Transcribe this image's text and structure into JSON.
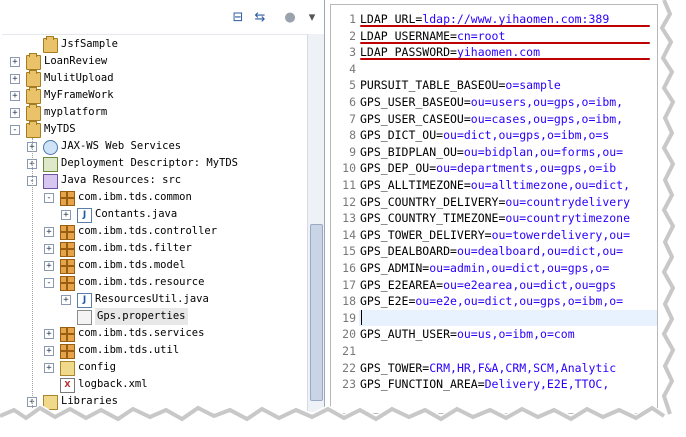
{
  "explorer": {
    "toolbar": [
      {
        "icon": "collapse-all-icon"
      },
      {
        "icon": "link-with-editor-icon"
      },
      {
        "icon": "view-menu-icon"
      },
      {
        "icon": "chevron-down-icon"
      }
    ],
    "tree": [
      {
        "label": "JsfSample",
        "icon": "project-icon",
        "depth": 1,
        "toggle": ""
      },
      {
        "label": "LoanReview",
        "icon": "project-icon",
        "depth": 0,
        "toggle": "+"
      },
      {
        "label": "MulitUpload",
        "icon": "project-icon",
        "depth": 0,
        "toggle": "+"
      },
      {
        "label": "MyFrameWork",
        "icon": "project-icon",
        "depth": 0,
        "toggle": "+"
      },
      {
        "label": "myplatform",
        "icon": "project-icon",
        "depth": 0,
        "toggle": "+"
      },
      {
        "label": "MyTDS",
        "icon": "project-icon",
        "depth": 0,
        "toggle": "-"
      },
      {
        "label": "JAX-WS Web Services",
        "icon": "web-services-icon",
        "depth": 1,
        "toggle": "+"
      },
      {
        "label": "Deployment Descriptor: MyTDS",
        "icon": "deployment-descriptor-icon",
        "depth": 1,
        "toggle": "+"
      },
      {
        "label": "Java Resources: src",
        "icon": "source-folder-icon",
        "depth": 1,
        "toggle": "-"
      },
      {
        "label": "com.ibm.tds.common",
        "icon": "package-icon",
        "depth": 2,
        "toggle": "-"
      },
      {
        "label": "Contants.java",
        "icon": "java-file-icon",
        "depth": 3,
        "toggle": "+"
      },
      {
        "label": "com.ibm.tds.controller",
        "icon": "package-icon",
        "depth": 2,
        "toggle": "+"
      },
      {
        "label": "com.ibm.tds.filter",
        "icon": "package-icon",
        "depth": 2,
        "toggle": "+"
      },
      {
        "label": "com.ibm.tds.model",
        "icon": "package-icon",
        "depth": 2,
        "toggle": "+"
      },
      {
        "label": "com.ibm.tds.resource",
        "icon": "package-icon",
        "depth": 2,
        "toggle": "-"
      },
      {
        "label": "ResourcesUtil.java",
        "icon": "java-file-icon",
        "depth": 3,
        "toggle": "+"
      },
      {
        "label": "Gps.properties",
        "icon": "properties-file-icon",
        "depth": 3,
        "toggle": "",
        "selected": true
      },
      {
        "label": "com.ibm.tds.services",
        "icon": "package-icon",
        "depth": 2,
        "toggle": "+"
      },
      {
        "label": "com.ibm.tds.util",
        "icon": "package-icon",
        "depth": 2,
        "toggle": "+"
      },
      {
        "label": "config",
        "icon": "folder-icon",
        "depth": 2,
        "toggle": "+"
      },
      {
        "label": "logback.xml",
        "icon": "xml-file-icon",
        "depth": 2,
        "toggle": ""
      },
      {
        "label": "Libraries",
        "icon": "library-icon",
        "depth": 1,
        "toggle": "+"
      }
    ]
  },
  "editor": {
    "lines": [
      {
        "n": "1",
        "key": "LDAP_URL=",
        "value": "ldap://www.yihaomen.com:389",
        "underline": true
      },
      {
        "n": "2",
        "key": "LDAP_USERNAME=",
        "value": "cn=root",
        "underline": true
      },
      {
        "n": "3",
        "key": "LDAP_PASSWORD=",
        "value": "yihaomen.com",
        "underline": true
      },
      {
        "n": "4",
        "key": "",
        "value": ""
      },
      {
        "n": "5",
        "key": "PURSUIT_TABLE_BASEOU=",
        "value": "o=sample"
      },
      {
        "n": "6",
        "key": "GPS_USER_BASEOU=",
        "value": "ou=users,ou=gps,o=ibm,"
      },
      {
        "n": "7",
        "key": "GPS_USER_CASEOU=",
        "value": "ou=cases,ou=gps,o=ibm,"
      },
      {
        "n": "8",
        "key": "GPS_DICT_OU=",
        "value": "ou=dict,ou=gps,o=ibm,o=s"
      },
      {
        "n": "9",
        "key": "GPS_BIDPLAN_OU=",
        "value": "ou=bidplan,ou=forms,ou="
      },
      {
        "n": "10",
        "key": "GPS_DEP_OU=",
        "value": "ou=departments,ou=gps,o=ib"
      },
      {
        "n": "11",
        "key": "GPS_ALLTIMEZONE=",
        "value": "ou=alltimezone,ou=dict,"
      },
      {
        "n": "12",
        "key": "GPS_COUNTRY_DELIVERY=",
        "value": "ou=countrydelivery"
      },
      {
        "n": "13",
        "key": "GPS_COUNTRY_TIMEZONE=",
        "value": "ou=countrytimezone"
      },
      {
        "n": "14",
        "key": "GPS_TOWER_DELIVERY=",
        "value": "ou=towerdelivery,ou="
      },
      {
        "n": "15",
        "key": "GPS_DEALBOARD=",
        "value": "ou=dealboard,ou=dict,ou="
      },
      {
        "n": "16",
        "key": "GPS_ADMIN=",
        "value": "ou=admin,ou=dict,ou=gps,o="
      },
      {
        "n": "17",
        "key": "GPS_E2EAREA=",
        "value": "ou=e2earea,ou=dict,ou=gps"
      },
      {
        "n": "18",
        "key": "GPS_E2E=",
        "value": "ou=e2e,ou=dict,ou=gps,o=ibm,o="
      },
      {
        "n": "19",
        "key": "",
        "value": "",
        "current": true
      },
      {
        "n": "20",
        "key": "GPS_AUTH_USER=",
        "value": "ou=us,o=ibm,o=com"
      },
      {
        "n": "21",
        "key": "",
        "value": ""
      },
      {
        "n": "22",
        "key": "GPS_TOWER=",
        "value": "CRM,HR,F&A,CRM,SCM,Analytic"
      },
      {
        "n": "23",
        "key": "GPS_FUNCTION_AREA=",
        "value": "Delivery,E2E,TTOC,"
      }
    ]
  }
}
